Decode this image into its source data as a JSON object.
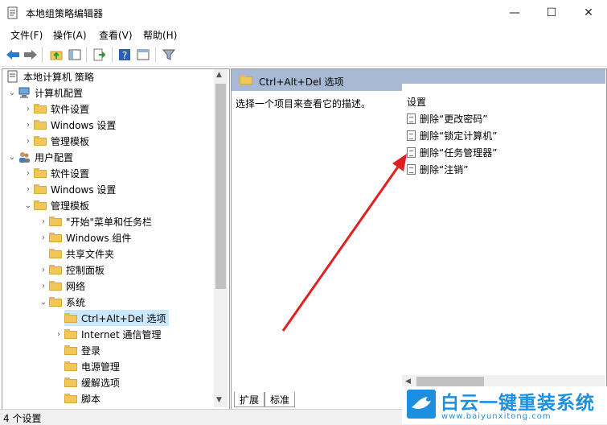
{
  "window": {
    "title": "本地组策略编辑器",
    "minimize": "—",
    "maximize": "☐",
    "close": "✕"
  },
  "menu": [
    "文件(F)",
    "操作(A)",
    "查看(V)",
    "帮助(H)"
  ],
  "toolbar_icons": [
    "back-arrow-icon",
    "forward-arrow-icon",
    "up-folder-icon",
    "show-tree-icon",
    "export-icon",
    "help-icon",
    "properties-icon",
    "filter-icon"
  ],
  "tree": {
    "root": "本地计算机 策略",
    "items": [
      {
        "label": "计算机配置"
      },
      {
        "label": "软件设置"
      },
      {
        "label": "Windows 设置"
      },
      {
        "label": "管理模板"
      },
      {
        "label": "用户配置"
      },
      {
        "label": "软件设置"
      },
      {
        "label": "Windows 设置"
      },
      {
        "label": "管理模板"
      },
      {
        "label": "\"开始\"菜单和任务栏"
      },
      {
        "label": "Windows 组件"
      },
      {
        "label": "共享文件夹"
      },
      {
        "label": "控制面板"
      },
      {
        "label": "网络"
      },
      {
        "label": "系统"
      },
      {
        "label": "Ctrl+Alt+Del 选项"
      },
      {
        "label": "Internet 通信管理"
      },
      {
        "label": "登录"
      },
      {
        "label": "电源管理"
      },
      {
        "label": "缓解选项"
      },
      {
        "label": "脚本"
      }
    ]
  },
  "detail": {
    "header": "Ctrl+Alt+Del 选项",
    "description": "选择一个项目来查看它的描述。",
    "settings_label": "设置",
    "settings": [
      "删除“更改密码”",
      "删除“锁定计算机”",
      "删除“任务管理器”",
      "删除“注销”"
    ]
  },
  "tabs": [
    "扩展",
    "标准"
  ],
  "status": "4 个设置",
  "watermark": {
    "title": "白云一键重装系统",
    "url": "www.baiyunxitong.com"
  },
  "colors": {
    "accent": "#1d8fe1",
    "header": "#a8b9d3",
    "selected": "#cce8ff",
    "arrow": "#e02020"
  }
}
